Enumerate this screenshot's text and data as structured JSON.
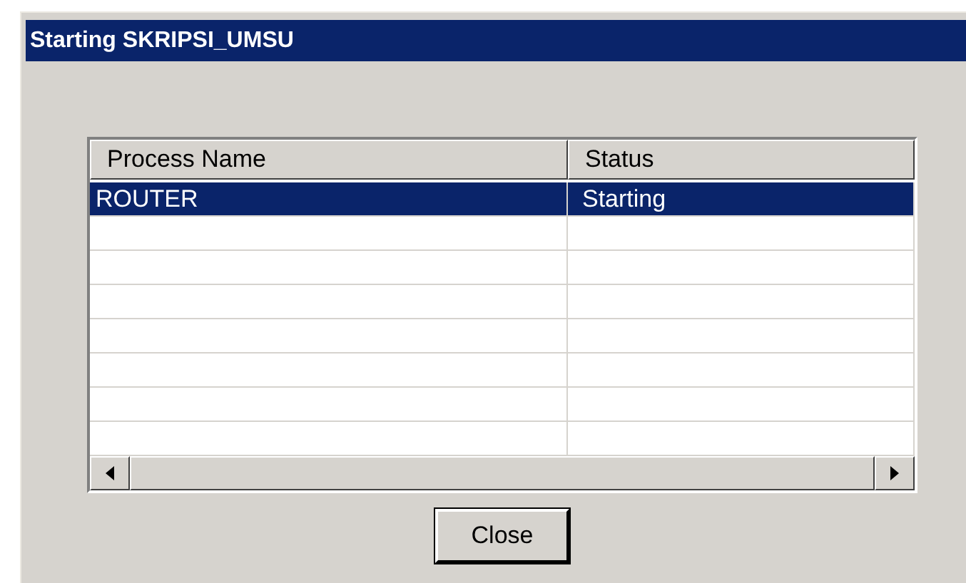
{
  "window": {
    "title": "Starting SKRIPSI_UMSU"
  },
  "table": {
    "columns": [
      "Process Name",
      "Status"
    ],
    "rows": [
      {
        "cells": [
          "ROUTER",
          "Starting"
        ],
        "selected": true
      }
    ]
  },
  "buttons": [
    "Close"
  ]
}
